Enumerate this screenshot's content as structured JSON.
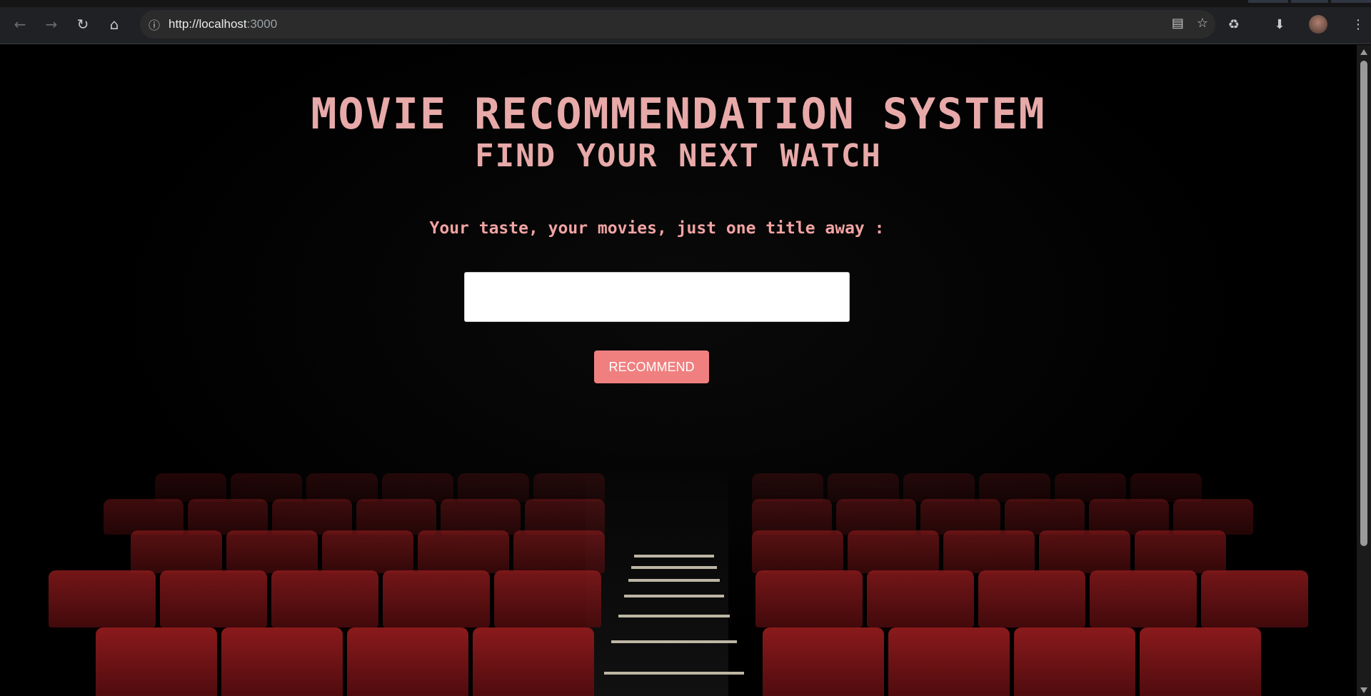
{
  "browser": {
    "url_host": "http://localhost",
    "url_port": ":3000",
    "icons": [
      "back-icon",
      "forward-icon",
      "reload-icon",
      "home-icon",
      "site-info-icon",
      "install-app-icon",
      "bookmark-star-icon",
      "extensions-icon",
      "download-icon",
      "profile-avatar",
      "menu-icon"
    ]
  },
  "page": {
    "title_line1": "MOVIE RECOMMENDATION SYSTEM",
    "title_line2": "FIND YOUR NEXT WATCH",
    "tagline": "Your taste, your movies, just one title away :",
    "input_value": "",
    "button_label": "RECOMMEND"
  },
  "colors": {
    "title": "#e8a9a9",
    "tagline": "#f2a3a3",
    "button_bg": "#f08080",
    "seat": "#8a1a1c"
  }
}
